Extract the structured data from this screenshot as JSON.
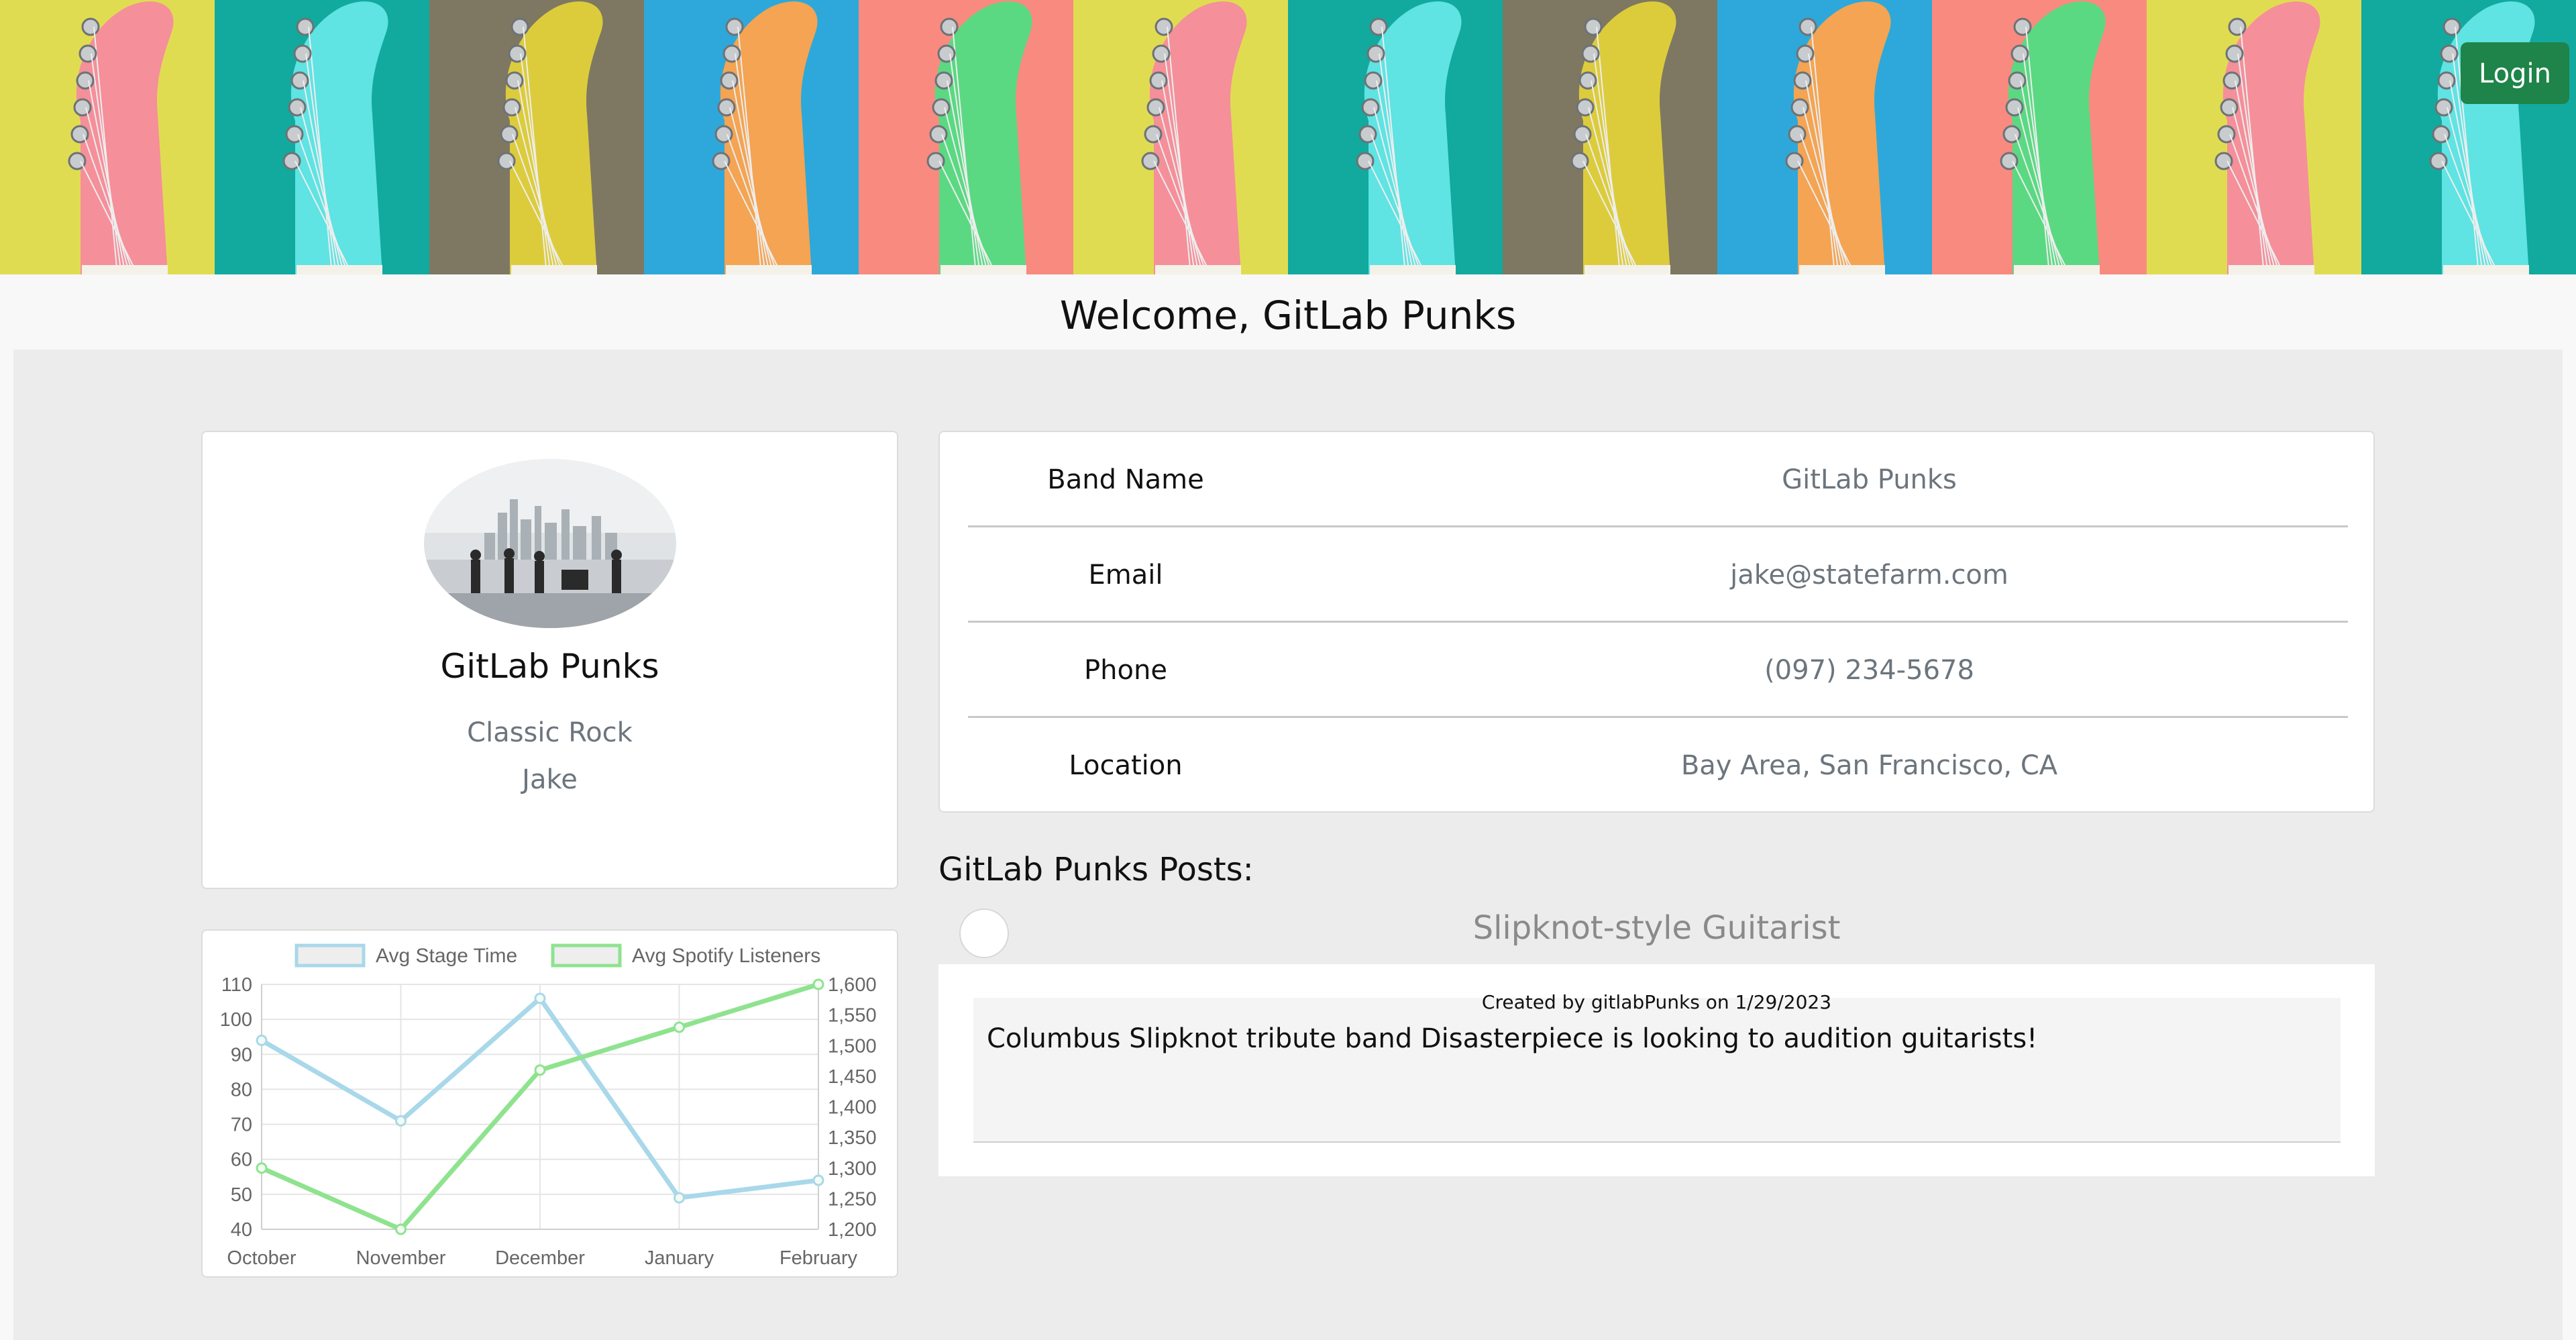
{
  "banner": {
    "tiles": [
      {
        "bg": "#e0dc52",
        "neck": "#f58f9a"
      },
      {
        "bg": "#12a99f",
        "neck": "#5fe3e3"
      },
      {
        "bg": "#7e7862",
        "neck": "#dccc3c"
      },
      {
        "bg": "#2ea8da",
        "neck": "#f4a452"
      },
      {
        "bg": "#f98a80",
        "neck": "#5ad982"
      },
      {
        "bg": "#e0dc52",
        "neck": "#f58f9a"
      },
      {
        "bg": "#12a99f",
        "neck": "#5fe3e3"
      },
      {
        "bg": "#7e7862",
        "neck": "#dccc3c"
      },
      {
        "bg": "#2ea8da",
        "neck": "#f4a452"
      },
      {
        "bg": "#f98a80",
        "neck": "#5ad982"
      },
      {
        "bg": "#e0dc52",
        "neck": "#f58f9a"
      },
      {
        "bg": "#12a99f",
        "neck": "#5fe3e3"
      }
    ]
  },
  "header": {
    "login_label": "Login",
    "welcome": "Welcome, GitLab Punks"
  },
  "profile": {
    "name": "GitLab Punks",
    "genre": "Classic Rock",
    "contact_name": "Jake"
  },
  "info": {
    "rows": [
      {
        "label": "Band Name",
        "value": "GitLab Punks"
      },
      {
        "label": "Email",
        "value": "jake@statefarm.com"
      },
      {
        "label": "Phone",
        "value": "(097) 234-5678"
      },
      {
        "label": "Location",
        "value": "Bay Area, San Francisco, CA"
      }
    ]
  },
  "posts": {
    "heading": "GitLab Punks Posts:",
    "items": [
      {
        "title": "Slipknot-style Guitarist",
        "meta": "Created by gitlabPunks on 1/29/2023",
        "body": "Columbus Slipknot tribute band Disasterpiece is looking to audition guitarists!"
      }
    ]
  },
  "chart_data": {
    "type": "line",
    "categories": [
      "October",
      "November",
      "December",
      "January",
      "February"
    ],
    "series": [
      {
        "name": "Avg Stage Time",
        "axis": "left",
        "color": "#a8d8ea",
        "values": [
          94,
          71,
          106,
          49,
          54
        ]
      },
      {
        "name": "Avg Spotify Listeners",
        "axis": "right",
        "color": "#8fe38f",
        "values": [
          1300,
          1200,
          1460,
          1530,
          1600
        ]
      }
    ],
    "y_left": {
      "min": 40,
      "max": 110,
      "ticks": [
        "110",
        "100",
        "90",
        "80",
        "70",
        "60",
        "50",
        "40"
      ]
    },
    "y_right": {
      "min": 1200,
      "max": 1600,
      "ticks": [
        "1,600",
        "1,550",
        "1,500",
        "1,450",
        "1,400",
        "1,350",
        "1,300",
        "1,250",
        "1,200"
      ]
    },
    "legend_position": "top",
    "grid": true
  }
}
